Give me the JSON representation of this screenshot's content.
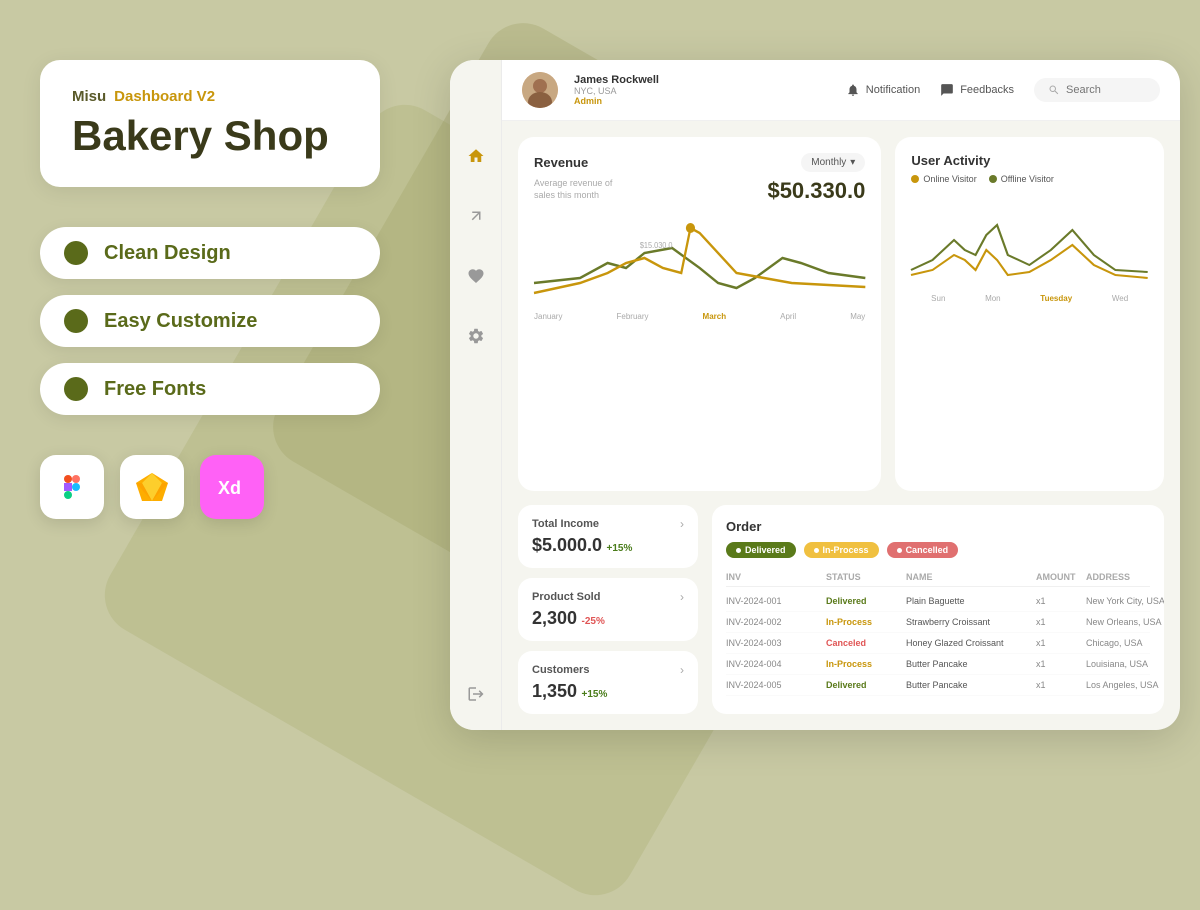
{
  "background": {
    "color": "#c8c9a3"
  },
  "left_panel": {
    "brand": "Misu",
    "subtitle": "Dashboard V2",
    "title": "Bakery Shop",
    "features": [
      {
        "id": "clean-design",
        "label": "Clean Design"
      },
      {
        "id": "easy-customize",
        "label": "Easy Customize"
      },
      {
        "id": "free-fonts",
        "label": "Free Fonts"
      }
    ],
    "tools": [
      {
        "id": "figma",
        "label": "Figma"
      },
      {
        "id": "sketch",
        "label": "Sketch"
      },
      {
        "id": "xd",
        "label": "Adobe XD"
      }
    ]
  },
  "dashboard": {
    "header": {
      "user": {
        "name": "James Rockwell",
        "location": "NYC, USA",
        "role": "Admin"
      },
      "notification_label": "Notification",
      "feedbacks_label": "Feedbacks",
      "search_placeholder": "Search"
    },
    "sidebar_icons": [
      "home",
      "tools",
      "heart",
      "settings",
      "logout"
    ],
    "revenue": {
      "title": "Revenue",
      "period_label": "Monthly",
      "subtitle": "Average revenue of sales this month",
      "value": "$50.330.0",
      "mid_label": "$15.030.0",
      "chart_labels": [
        "January",
        "February",
        "March",
        "April",
        "May"
      ],
      "active_label": "March"
    },
    "user_activity": {
      "title": "User Activity",
      "legend": [
        {
          "label": "Online Visitor",
          "color": "#c8960c"
        },
        {
          "label": "Offline Visitor",
          "color": "#6a7a2a"
        }
      ],
      "chart_labels": [
        "Sun",
        "Mon",
        "Tuesday",
        "Wed"
      ],
      "active_label": "Tuesday"
    },
    "stats": [
      {
        "title": "Total Income",
        "value": "$5.000.0",
        "change": "+15%",
        "change_type": "positive"
      },
      {
        "title": "Product Sold",
        "value": "2,300",
        "change": "-25%",
        "change_type": "negative"
      },
      {
        "title": "Customers",
        "value": "1,350",
        "change": "+15%",
        "change_type": "positive"
      }
    ],
    "orders": {
      "title": "Order",
      "badges": [
        {
          "label": "Delivered",
          "type": "delivered"
        },
        {
          "label": "In-Process",
          "type": "inprocess"
        },
        {
          "label": "Cancelled",
          "type": "cancelled"
        }
      ],
      "columns": [
        "Inv",
        "Status",
        "Name",
        "Amount",
        "Address"
      ],
      "rows": [
        {
          "inv": "INV-2024-001",
          "status": "Delivered",
          "status_type": "delivered",
          "name": "Plain Baguette",
          "amount": "x1",
          "address": "New York City, USA"
        },
        {
          "inv": "INV-2024-002",
          "status": "In-Process",
          "status_type": "inprocess",
          "name": "Strawberry Croissant",
          "amount": "x1",
          "address": "New Orleans, USA"
        },
        {
          "inv": "INV-2024-003",
          "status": "Canceled",
          "status_type": "cancelled",
          "name": "Honey Glazed Croissant",
          "amount": "x1",
          "address": "Chicago, USA"
        },
        {
          "inv": "INV-2024-004",
          "status": "In-Process",
          "status_type": "inprocess",
          "name": "Butter Pancake",
          "amount": "x1",
          "address": "Louisiana, USA"
        },
        {
          "inv": "INV-2024-005",
          "status": "Delivered",
          "status_type": "delivered",
          "name": "Butter Pancake",
          "amount": "x1",
          "address": "Los Angeles, USA"
        }
      ]
    }
  }
}
